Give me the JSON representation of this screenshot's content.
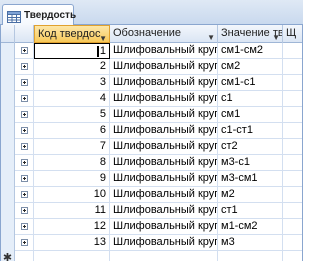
{
  "tab": {
    "title": "Твердость",
    "icon": "table-icon"
  },
  "columns": [
    {
      "label": ""
    },
    {
      "label": "Код твердос"
    },
    {
      "label": "Обозначение"
    },
    {
      "label": "Значение тв"
    },
    {
      "label": "Щ"
    }
  ],
  "rows": [
    {
      "code": "1",
      "name": "Шлифовальный круг",
      "value": "см1-см2"
    },
    {
      "code": "2",
      "name": "Шлифовальный круг",
      "value": "см2"
    },
    {
      "code": "3",
      "name": "Шлифовальный круг",
      "value": "см1-с1"
    },
    {
      "code": "4",
      "name": "Шлифовальный круг",
      "value": "с1"
    },
    {
      "code": "5",
      "name": "Шлифовальный круг",
      "value": "см1"
    },
    {
      "code": "6",
      "name": "Шлифовальный круг",
      "value": "с1-ст1"
    },
    {
      "code": "7",
      "name": "Шлифовальный круг",
      "value": "ст2"
    },
    {
      "code": "8",
      "name": "Шлифовальный круг",
      "value": "м3-с1"
    },
    {
      "code": "9",
      "name": "Шлифовальный круг",
      "value": "м3-см1"
    },
    {
      "code": "10",
      "name": "Шлифовальный круг",
      "value": "м2"
    },
    {
      "code": "11",
      "name": "Шлифовальный круг",
      "value": "ст1"
    },
    {
      "code": "12",
      "name": "Шлифовальный круг",
      "value": "м1-см2"
    },
    {
      "code": "13",
      "name": "Шлифовальный круг",
      "value": "м3"
    }
  ],
  "new_row_marker": "✱"
}
